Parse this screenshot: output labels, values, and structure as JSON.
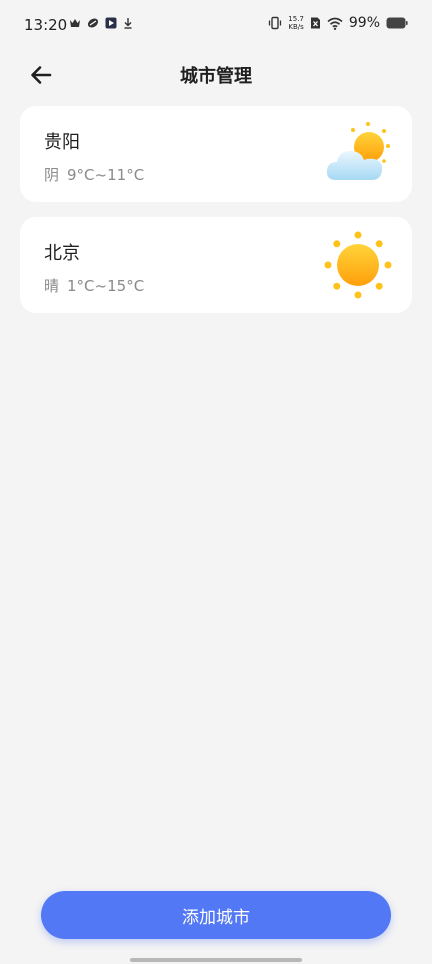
{
  "status_bar": {
    "time": "13:20",
    "net_speed_value": "15.7",
    "net_speed_unit": "KB/s",
    "battery": "99%"
  },
  "header": {
    "title": "城市管理"
  },
  "cities": [
    {
      "name": "贵阳",
      "condition": "阴",
      "temp_range": "9°C~11°C",
      "icon": "partly-cloudy-icon"
    },
    {
      "name": "北京",
      "condition": "晴",
      "temp_range": "1°C~15°C",
      "icon": "sunny-icon"
    }
  ],
  "add_button": {
    "label": "添加城市"
  },
  "colors": {
    "accent": "#5278f5",
    "background": "#f4f4f4",
    "card": "#ffffff",
    "secondary_text": "#8a8a8a"
  }
}
